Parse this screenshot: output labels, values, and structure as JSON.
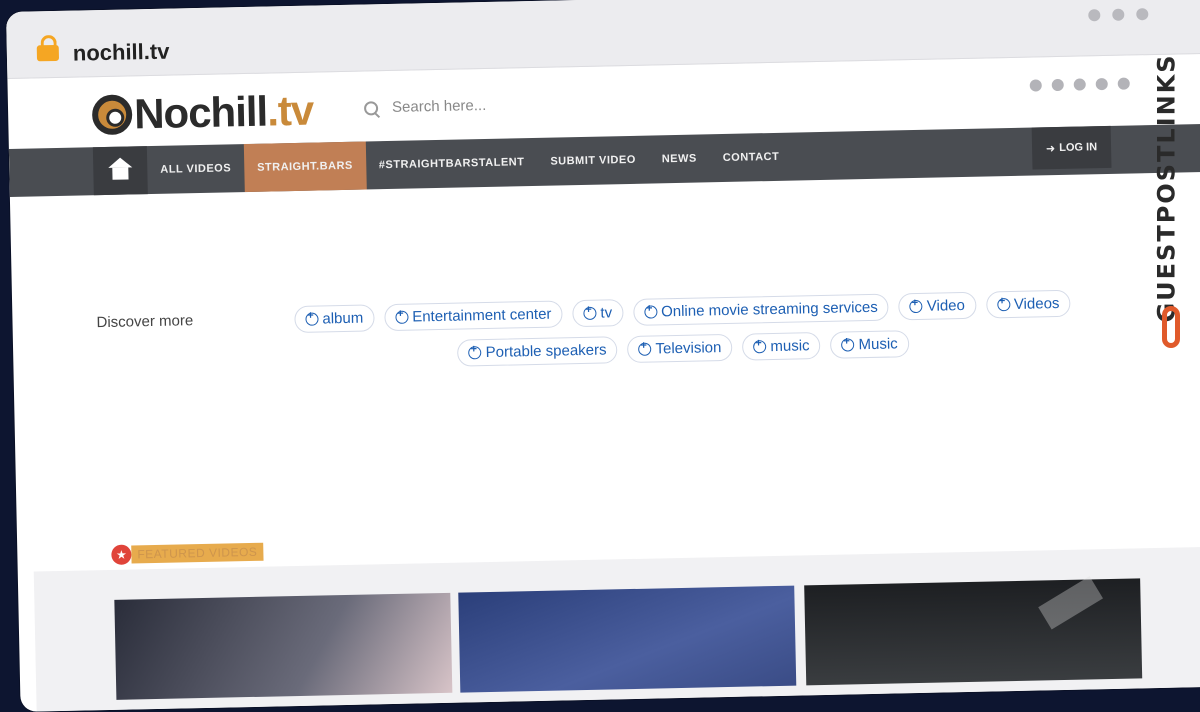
{
  "browser": {
    "url": "nochill.tv"
  },
  "header": {
    "logo_main": "Nochill",
    "logo_suffix": ".tv",
    "search_placeholder": "Search here..."
  },
  "nav": {
    "items": [
      "ALL VIDEOS",
      "STRAIGHT.BARS",
      "#STRAIGHTBARSTALENT",
      "SUBMIT VIDEO",
      "NEWS",
      "CONTACT"
    ],
    "active": "STRAIGHT.BARS",
    "login": "LOG IN"
  },
  "discover": {
    "label": "Discover more",
    "chips": [
      "album",
      "Entertainment center",
      "tv",
      "Online movie streaming services",
      "Video",
      "Videos",
      "Portable speakers",
      "Television",
      "music",
      "Music"
    ]
  },
  "featured": {
    "label": "FEATURED VIDEOS"
  },
  "watermark": {
    "text": "GUESTPOSTLINKS"
  },
  "colors": {
    "accent": "#c17f55",
    "nav_bg": "#4a4d52",
    "chip_text": "#1d5fb3",
    "brand_orange": "#e05a2b"
  },
  "icons": {
    "lock": "lock-icon",
    "search": "search-icon",
    "home": "home-icon",
    "login": "login-icon",
    "chip": "plus-circle-icon",
    "star": "star-icon"
  }
}
